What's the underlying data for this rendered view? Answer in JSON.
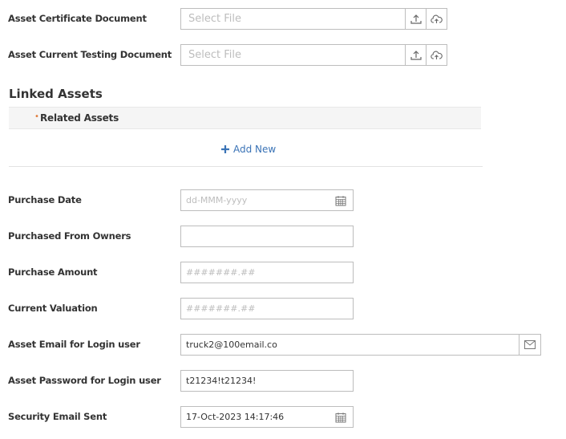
{
  "documents": [
    {
      "label": "Asset Certificate Document",
      "placeholder": "Select File"
    },
    {
      "label": "Asset Current Testing Document",
      "placeholder": "Select File"
    }
  ],
  "linked_assets": {
    "title": "Linked Assets",
    "bullet": "•",
    "subheader": "Related Assets",
    "add_new": "Add New"
  },
  "fields": {
    "purchase_date": {
      "label": "Purchase Date",
      "placeholder": "dd-MMM-yyyy"
    },
    "purchased_from": {
      "label": "Purchased From Owners",
      "value": ""
    },
    "purchase_amount": {
      "label": "Purchase Amount",
      "placeholder": "#######.##"
    },
    "current_valuation": {
      "label": "Current Valuation",
      "placeholder": "#######.##"
    },
    "asset_email": {
      "label": "Asset Email for Login user",
      "value": "truck2@100email.co"
    },
    "asset_password": {
      "label": "Asset Password for Login user",
      "value": "t21234!t21234!"
    },
    "security_email_sent": {
      "label": "Security Email Sent",
      "value": "17-Oct-2023 14:17:46"
    }
  },
  "colors": {
    "accent": "#3a73b6",
    "border": "#bdbdbd",
    "placeholder": "#bdbdbd",
    "required_bullet": "#e07b39"
  }
}
